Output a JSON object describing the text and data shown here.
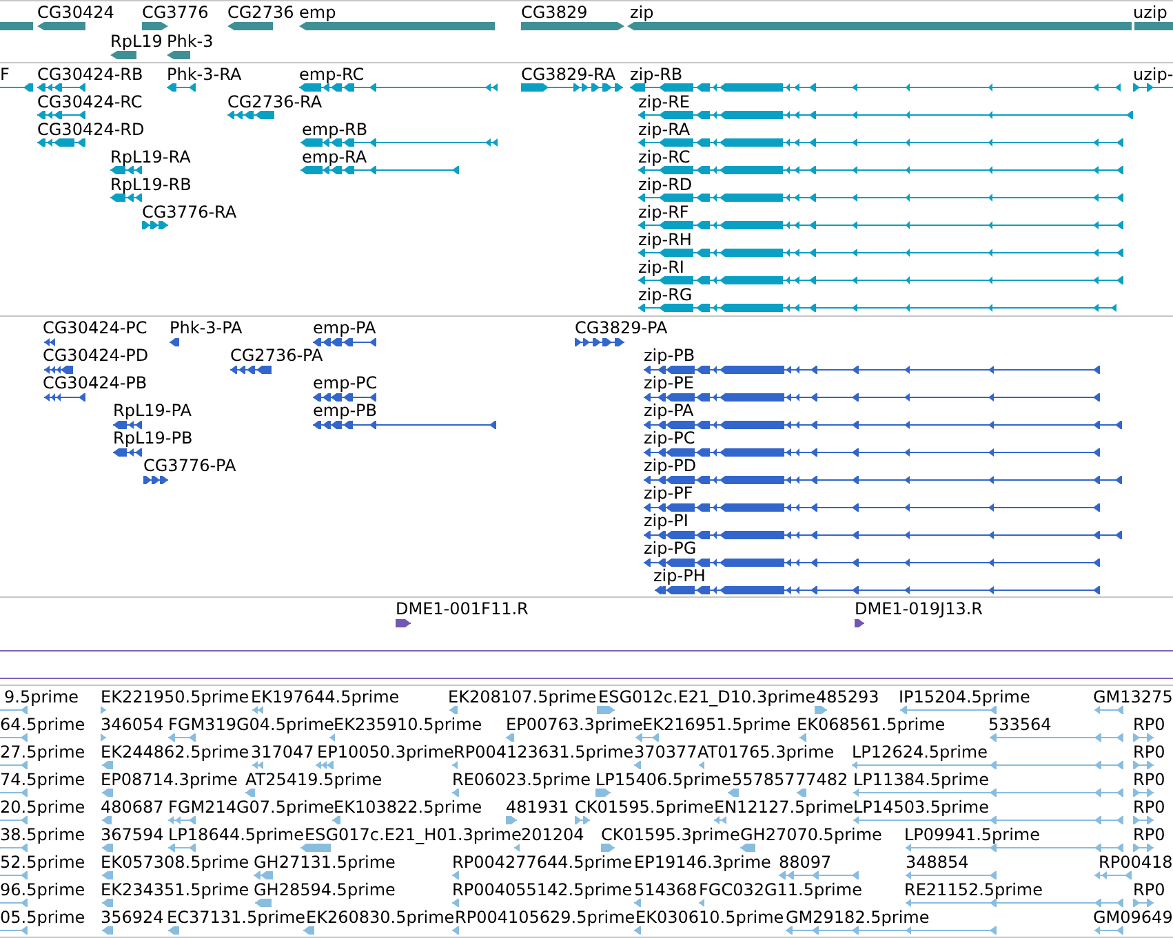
{
  "tracks": [
    {
      "kind": "gene",
      "features": [
        {
          "reverse": true
        },
        {
          "label": "CG30424",
          "reverse": true
        },
        {
          "label": "CG3776",
          "reverse": false
        },
        {
          "label": "CG2736",
          "reverse": true
        },
        {
          "label": "emp",
          "reverse": true
        },
        {
          "label": "CG3829",
          "reverse": false
        },
        {
          "label": "zip",
          "reverse": true
        },
        {
          "label": "uzip",
          "reverse": false
        },
        {
          "label": "RpL19",
          "reverse": true
        },
        {
          "label": "Phk-3",
          "reverse": true
        }
      ]
    },
    {
      "kind": "transcript",
      "features": [
        {
          "label": "F",
          "reverse": true
        },
        {
          "label": "CG30424-RB",
          "reverse": true
        },
        {
          "label": "Phk-3-RA",
          "reverse": true
        },
        {
          "label": "emp-RC",
          "reverse": true
        },
        {
          "label": "CG3829-RA",
          "reverse": false
        },
        {
          "label": "zip-RB",
          "reverse": true
        },
        {
          "label": "uzip-",
          "reverse": false
        },
        {
          "label": "CG30424-RC",
          "reverse": true
        },
        {
          "label": "CG2736-RA",
          "reverse": true
        },
        {
          "label": "zip-RE",
          "reverse": true
        },
        {
          "label": "CG30424-RD",
          "reverse": true
        },
        {
          "label": "emp-RB",
          "reverse": true
        },
        {
          "label": "zip-RA",
          "reverse": true
        },
        {
          "label": "RpL19-RA",
          "reverse": true
        },
        {
          "label": "emp-RA",
          "reverse": true
        },
        {
          "label": "zip-RC",
          "reverse": true
        },
        {
          "label": "RpL19-RB",
          "reverse": true
        },
        {
          "label": "zip-RD",
          "reverse": true
        },
        {
          "label": "CG3776-RA",
          "reverse": false
        },
        {
          "label": "zip-RF",
          "reverse": true
        },
        {
          "label": "zip-RH",
          "reverse": true
        },
        {
          "label": "zip-RI",
          "reverse": true
        },
        {
          "label": "zip-RG",
          "reverse": true
        }
      ]
    },
    {
      "kind": "protein",
      "features": [
        {
          "label": "CG30424-PC",
          "reverse": true
        },
        {
          "label": "Phk-3-PA",
          "reverse": true
        },
        {
          "label": "emp-PA",
          "reverse": true
        },
        {
          "label": "CG3829-PA",
          "reverse": false
        },
        {
          "label": "CG30424-PD",
          "reverse": true
        },
        {
          "label": "CG2736-PA",
          "reverse": true
        },
        {
          "label": "zip-PB",
          "reverse": true
        },
        {
          "label": "CG30424-PB",
          "reverse": true
        },
        {
          "label": "emp-PC",
          "reverse": true
        },
        {
          "label": "zip-PE",
          "reverse": true
        },
        {
          "label": "RpL19-PA",
          "reverse": true
        },
        {
          "label": "emp-PB",
          "reverse": true
        },
        {
          "label": "zip-PA",
          "reverse": true
        },
        {
          "label": "RpL19-PB",
          "reverse": true
        },
        {
          "label": "zip-PC",
          "reverse": true
        },
        {
          "label": "CG3776-PA",
          "reverse": false
        },
        {
          "label": "zip-PD",
          "reverse": true
        },
        {
          "label": "zip-PF",
          "reverse": true
        },
        {
          "label": "zip-PI",
          "reverse": true
        },
        {
          "label": "zip-PG",
          "reverse": true
        },
        {
          "label": "zip-PH",
          "reverse": true
        }
      ]
    },
    {
      "kind": "clone",
      "features": [
        {
          "label": "DME1-001F11.R",
          "reverse": false
        },
        {
          "label": "DME1-019J13.R",
          "reverse": false
        }
      ]
    },
    {
      "kind": "band"
    },
    {
      "kind": "est",
      "features": [
        {
          "label": "9.5prime",
          "reverse": true
        },
        {
          "label": "EK221950.5prime",
          "reverse": false
        },
        {
          "label": "EK197644.5prime",
          "reverse": true
        },
        {
          "label": "EK208107.5prime",
          "reverse": true
        },
        {
          "label": "ESG012c.E21_D10.3prime",
          "reverse": false
        },
        {
          "label": "485293",
          "reverse": false
        },
        {
          "label": "IP15204.5prime",
          "reverse": true
        },
        {
          "label": "GM13275",
          "reverse": true
        },
        {
          "label": "64.5prime",
          "reverse": true
        },
        {
          "label": "346054",
          "reverse": false
        },
        {
          "label": "FGM319G04.5prime",
          "reverse": true
        },
        {
          "label": "EK235910.5prime",
          "reverse": true
        },
        {
          "label": "EP00763.3prime",
          "reverse": true
        },
        {
          "label": "EK216951.5prime",
          "reverse": true
        },
        {
          "label": "EK068561.5prime",
          "reverse": true
        },
        {
          "label": "533564",
          "reverse": true
        },
        {
          "label": "RP0",
          "reverse": false
        },
        {
          "label": "27.5prime",
          "reverse": true
        },
        {
          "label": "EK244862.5prime",
          "reverse": true
        },
        {
          "label": "317047",
          "reverse": true
        },
        {
          "label": "EP10050.3prime",
          "reverse": true
        },
        {
          "label": "RP004123631.5prime",
          "reverse": true
        },
        {
          "label": "370377",
          "reverse": true
        },
        {
          "label": "AT01765.3prime",
          "reverse": true
        },
        {
          "label": "LP12624.5prime",
          "reverse": true
        },
        {
          "label": "RP0",
          "reverse": false
        },
        {
          "label": "74.5prime",
          "reverse": true
        },
        {
          "label": "EP08714.3prime",
          "reverse": true
        },
        {
          "label": "AT25419.5prime",
          "reverse": true
        },
        {
          "label": "RE06023.5prime",
          "reverse": true
        },
        {
          "label": "LP15406.5prime",
          "reverse": false
        },
        {
          "label": "557857",
          "reverse": true
        },
        {
          "label": "77482",
          "reverse": true
        },
        {
          "label": "LP11384.5prime",
          "reverse": true
        },
        {
          "label": "RP0",
          "reverse": false
        },
        {
          "label": "20.5prime",
          "reverse": true
        },
        {
          "label": "480687",
          "reverse": true
        },
        {
          "label": "FGM214G07.5prime",
          "reverse": true
        },
        {
          "label": "EK103822.5prime",
          "reverse": true
        },
        {
          "label": "481931",
          "reverse": false
        },
        {
          "label": "CK01595.5prime",
          "reverse": false
        },
        {
          "label": "EN12127.5prime",
          "reverse": true
        },
        {
          "label": "LP14503.5prime",
          "reverse": true
        },
        {
          "label": "RP0",
          "reverse": false
        },
        {
          "label": "38.5prime",
          "reverse": true
        },
        {
          "label": "367594",
          "reverse": true
        },
        {
          "label": "LP18644.5prime",
          "reverse": true
        },
        {
          "label": "ESG017c.E21_H01.3prime",
          "reverse": true
        },
        {
          "label": "201204",
          "reverse": true
        },
        {
          "label": "CK01595.3prime",
          "reverse": false
        },
        {
          "label": "GH27070.5prime",
          "reverse": true
        },
        {
          "label": "LP09941.5prime",
          "reverse": true
        },
        {
          "label": "RP0",
          "reverse": false
        },
        {
          "label": "52.5prime",
          "reverse": true
        },
        {
          "label": "EK057308.5prime",
          "reverse": true
        },
        {
          "label": "GH27131.5prime",
          "reverse": true
        },
        {
          "label": "RP004277644.5prime",
          "reverse": true
        },
        {
          "label": "EP19146.3prime"
        },
        {
          "label": "88097",
          "reverse": true
        },
        {
          "label": "348854",
          "reverse": true
        },
        {
          "label": "RP00418",
          "reverse": true
        },
        {
          "label": "96.5prime",
          "reverse": true
        },
        {
          "label": "EK234351.5prime",
          "reverse": true
        },
        {
          "label": "GH28594.5prime",
          "reverse": true
        },
        {
          "label": "RP004055142.5prime",
          "reverse": true
        },
        {
          "label": "514368",
          "reverse": true
        },
        {
          "label": "FGC032G11.5prime",
          "reverse": true
        },
        {
          "label": "RE21152.5prime",
          "reverse": true
        },
        {
          "label": "RP0",
          "reverse": false
        },
        {
          "label": "05.5prime",
          "reverse": true
        },
        {
          "label": "356924",
          "reverse": true
        },
        {
          "label": "EC37131.5prime",
          "reverse": true
        },
        {
          "label": "EK260830.5prime",
          "reverse": true
        },
        {
          "label": "RP004105629.5prime",
          "reverse": true
        },
        {
          "label": "EK030610.5prime",
          "reverse": true
        },
        {
          "label": "GM29182.5prime",
          "reverse": true
        },
        {
          "label": "GM09649",
          "reverse": true
        }
      ]
    }
  ]
}
